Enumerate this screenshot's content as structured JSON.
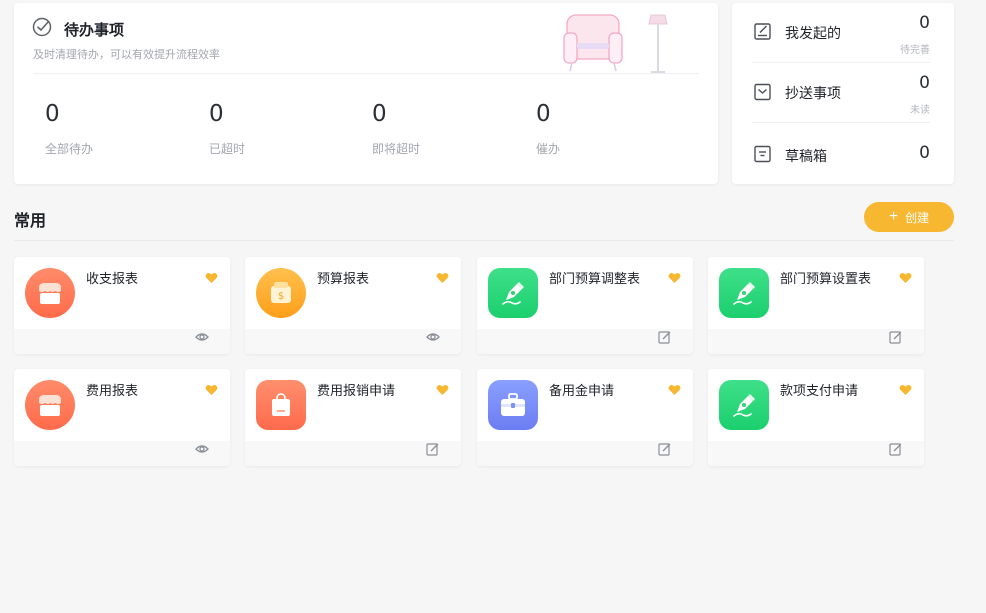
{
  "todo": {
    "title": "待办事项",
    "subtitle": "及时清理待办，可以有效提升流程效率",
    "stats": [
      {
        "value": "0",
        "label": "全部待办"
      },
      {
        "value": "0",
        "label": "已超时"
      },
      {
        "value": "0",
        "label": "即将超时"
      },
      {
        "value": "0",
        "label": "催办"
      }
    ]
  },
  "summary": {
    "items": [
      {
        "label": "我发起的",
        "count": "0",
        "sub": "待完善",
        "icon": "edit-icon"
      },
      {
        "label": "抄送事项",
        "count": "0",
        "sub": "未读",
        "icon": "inbox-icon"
      },
      {
        "label": "草稿箱",
        "count": "0",
        "icon": "draft-box-icon"
      }
    ]
  },
  "common": {
    "title": "常用",
    "create_label": "创建"
  },
  "apps": [
    {
      "name": "收支报表",
      "icon": "shop-icon",
      "action": "view-icon",
      "color": "#ff7a59"
    },
    {
      "name": "预算报表",
      "icon": "money-bag-icon",
      "action": "view-icon",
      "color": "#ffad2a"
    },
    {
      "name": "部门预算调整表",
      "icon": "pen-icon",
      "action": "edit-icon",
      "color": "#2ed573"
    },
    {
      "name": "部门预算设置表",
      "icon": "pen-icon",
      "action": "edit-icon",
      "color": "#2ed573"
    },
    {
      "name": "费用报表",
      "icon": "shop-icon",
      "action": "view-icon",
      "color": "#ff7a59"
    },
    {
      "name": "费用报销申请",
      "icon": "shopping-bag-icon",
      "action": "edit-icon",
      "color": "#ff7a59"
    },
    {
      "name": "备用金申请",
      "icon": "briefcase-icon",
      "action": "edit-icon",
      "color": "#7b8ff7"
    },
    {
      "name": "款项支付申请",
      "icon": "pen-icon",
      "action": "edit-icon",
      "color": "#2ed573"
    }
  ],
  "colors": {
    "accent": "#f7b731",
    "favorite": "#f7b731"
  }
}
